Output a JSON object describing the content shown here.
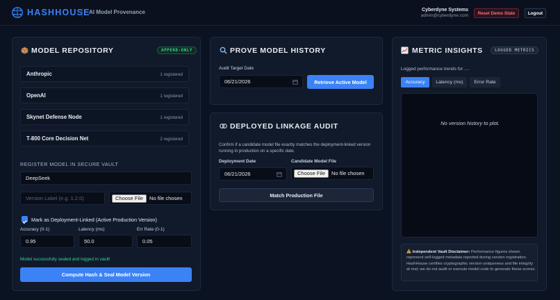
{
  "header": {
    "brand": "HASHHOUSE",
    "tagline": "AI Model Provenance",
    "org_name": "Cyberdyne Systems",
    "org_email": "admin@cyberdyne.com",
    "reset_label": "Reset Demo State",
    "logout_label": "Logout"
  },
  "repository": {
    "title": "MODEL REPOSITORY",
    "badge": "APPEND-ONLY",
    "providers": [
      {
        "name": "Anthropic",
        "count": "1 registered"
      },
      {
        "name": "OpenAI",
        "count": "1 registered"
      },
      {
        "name": "Skynet Defense Node",
        "count": "1 registered"
      },
      {
        "name": "T-800 Core Decision Net",
        "count": "2 registered"
      }
    ],
    "register_label": "REGISTER MODEL IN SECURE VAULT",
    "provider_value": "DeepSeek",
    "version_placeholder": "Version Label (e.g. 1.2.0)",
    "file_button": "Choose File",
    "file_status": "No file chosen",
    "deployment_linked_label": "Mark as Deployment-Linked (Active Production Version)",
    "accuracy_label": "Accuracy (0-1)",
    "accuracy_value": "0.95",
    "latency_label": "Latency (ms)",
    "latency_value": "50.0",
    "err_label": "Err Rate (0-1)",
    "err_value": "0.05",
    "success_message": "Model successfully sealed and logged in vault!",
    "submit_label": "Compute Hash & Seal Model Version"
  },
  "prove": {
    "title": "PROVE MODEL HISTORY",
    "date_label": "Audit Target Date",
    "date_value": "06/21/2026",
    "button_label": "Retrieve Active Model"
  },
  "linkage": {
    "title": "DEPLOYED LINKAGE AUDIT",
    "description": "Confirm if a candidate model file exactly matches the deployment-linked version running in production on a specific date.",
    "date_label": "Deployment Date",
    "date_value": "06/21/2026",
    "file_label": "Candidate Model File",
    "file_button": "Choose File",
    "file_status": "No file chosen",
    "button_label": "Match Production File"
  },
  "metrics": {
    "title": "METRIC INSIGHTS",
    "badge": "LOGGED METRICS",
    "subtitle": "Logged performance trends for ....",
    "tabs": [
      "Accuracy",
      "Latency (ms)",
      "Error Rate"
    ],
    "empty_message": "No version history to plot.",
    "disclaimer_title": "Independent Vault Disclaimer:",
    "disclaimer_body": "Performance figures shown represent self-logged metadata reported during version registration. HashHouse certifies cryptographic version uniqueness and file integrity at rest; we do not audit or execute model code to generate these scores."
  },
  "colors": {
    "accent": "#3b82f6",
    "success": "#34d399",
    "danger": "#f87171",
    "background": "#0b1221",
    "panel": "#111a2b"
  },
  "icons": {
    "logo": "circuit-brain-icon",
    "repository": "package-icon",
    "prove": "magnifier-icon",
    "linkage": "chain-link-icon",
    "metrics": "chart-icon",
    "disclaimer": "warning-icon",
    "calendar": "calendar-icon"
  }
}
